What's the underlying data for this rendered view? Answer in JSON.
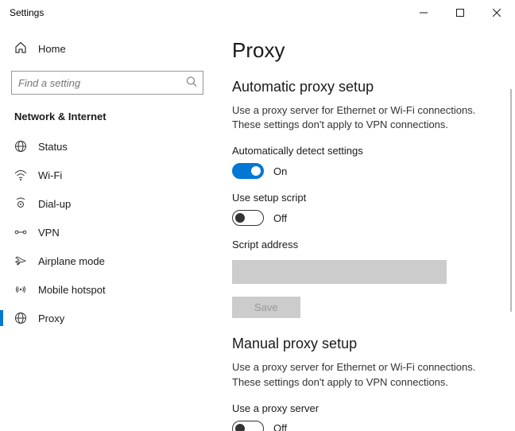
{
  "window": {
    "title": "Settings"
  },
  "sidebar": {
    "home_label": "Home",
    "search_placeholder": "Find a setting",
    "section_header": "Network & Internet",
    "items": [
      {
        "label": "Status"
      },
      {
        "label": "Wi-Fi"
      },
      {
        "label": "Dial-up"
      },
      {
        "label": "VPN"
      },
      {
        "label": "Airplane mode"
      },
      {
        "label": "Mobile hotspot"
      },
      {
        "label": "Proxy"
      }
    ]
  },
  "page": {
    "title": "Proxy",
    "auto": {
      "heading": "Automatic proxy setup",
      "desc": "Use a proxy server for Ethernet or Wi-Fi connections. These settings don't apply to VPN connections.",
      "detect_label": "Automatically detect settings",
      "detect_state": "On",
      "setup_label": "Use setup script",
      "setup_state": "Off",
      "script_label": "Script address",
      "script_value": "",
      "save_label": "Save"
    },
    "manual": {
      "heading": "Manual proxy setup",
      "desc": "Use a proxy server for Ethernet or Wi-Fi connections. These settings don't apply to VPN connections.",
      "use_label": "Use a proxy server",
      "use_state": "Off"
    }
  }
}
